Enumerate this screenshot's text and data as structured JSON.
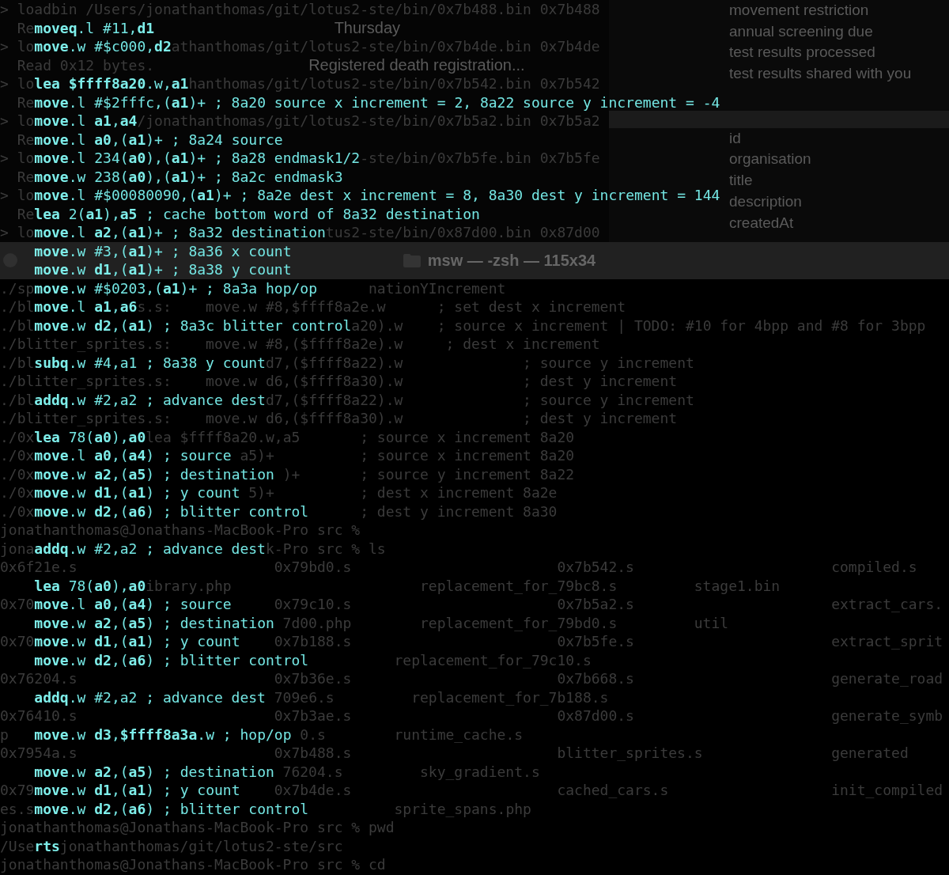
{
  "top_terminal": {
    "rows": [
      {
        "segments": [
          {
            "text": "> loadbin /Users/jonathanthomas/git/lotus2-ste/bin/0x7b488.bin 0x7b488",
            "kind": "term"
          }
        ]
      },
      {
        "segments": [
          {
            "text": "  Re",
            "kind": "term"
          },
          {
            "text": "                                   Thursday",
            "kind": "page"
          }
        ]
      },
      {
        "segments": [
          {
            "text": "> lo",
            "kind": "term"
          },
          {
            "text": "                athanthomas/git/lotus2-ste/bin/0x7b4de.bin 0x7b4de",
            "kind": "term"
          }
        ]
      },
      {
        "segments": [
          {
            "text": "  Read 0x12 bytes.",
            "kind": "term"
          },
          {
            "text": "                  Registered death registration...",
            "kind": "page"
          }
        ]
      },
      {
        "segments": [
          {
            "text": "> lo",
            "kind": "term"
          },
          {
            "text": "                  hanthomas/git/lotus2-ste/bin/0x7b542.bin 0x7b542",
            "kind": "term"
          }
        ]
      },
      {
        "segments": [
          {
            "text": "  Re",
            "kind": "term"
          }
        ]
      },
      {
        "segments": [
          {
            "text": "> lo",
            "kind": "term"
          },
          {
            "text": "            /jonathanthomas/git/lotus2-ste/bin/0x7b5a2.bin 0x7b5a2",
            "kind": "term"
          }
        ]
      },
      {
        "segments": [
          {
            "text": "  Re",
            "kind": "term"
          }
        ]
      },
      {
        "segments": [
          {
            "text": "> lo",
            "kind": "term"
          },
          {
            "text": "                                      -ste/bin/0x7b5fe.bin 0x7b5fe",
            "kind": "term"
          }
        ]
      },
      {
        "segments": [
          {
            "text": "  Re",
            "kind": "term"
          }
        ]
      },
      {
        "segments": [
          {
            "text": "> lo",
            "kind": "term"
          }
        ]
      },
      {
        "segments": [
          {
            "text": "  Re",
            "kind": "term"
          }
        ]
      },
      {
        "segments": [
          {
            "text": "> lo",
            "kind": "term"
          },
          {
            "text": "                                  tus2-ste/bin/0x87d00.bin 0x87d00",
            "kind": "term"
          }
        ]
      }
    ]
  },
  "browser_panel": {
    "upper_items": [
      "movement restriction",
      "annual screening due",
      "test results processed",
      "test results shared with you"
    ],
    "lower_items": [
      "id",
      "organisation",
      "title",
      "description",
      "createdAt"
    ]
  },
  "title_bar": {
    "title": "msw — -zsh — 115x34"
  },
  "terminal": {
    "rows": [
      {
        "segments": [
          {
            "text": "./sp",
            "kind": "term"
          },
          {
            "text": "                                       nationYIncrement",
            "kind": "term"
          }
        ]
      },
      {
        "segments": [
          {
            "text": "./bl",
            "kind": "term"
          },
          {
            "text": "            s.s:    move.w #8,$ffff8a2e.w      ; set dest x increment",
            "kind": "term"
          }
        ]
      },
      {
        "segments": [
          {
            "text": "./bl",
            "kind": "term"
          },
          {
            "text": "                                     a20).w    ; source x increment | TODO: #10 for 4bpp and #8 for 3bpp",
            "kind": "term"
          }
        ]
      },
      {
        "segments": [
          {
            "text": "./blitter_sprites.s:    move.w #8,($ffff8a2e).w     ; dest x increment",
            "kind": "term"
          }
        ]
      },
      {
        "segments": [
          {
            "text": "./bl",
            "kind": "term"
          },
          {
            "text": "                           d7,($ffff8a22).w              ; source y increment",
            "kind": "term"
          }
        ]
      },
      {
        "segments": [
          {
            "text": "./blitter_sprites.s:    move.w d6,($ffff8a30).w              ; dest y increment",
            "kind": "term"
          }
        ]
      },
      {
        "segments": [
          {
            "text": "./bl",
            "kind": "term"
          },
          {
            "text": "                           d7,($ffff8a22).w              ; source y increment",
            "kind": "term"
          }
        ]
      },
      {
        "segments": [
          {
            "text": "./blitter_sprites.s:    move.w d6,($ffff8a30).w              ; dest y increment",
            "kind": "term"
          }
        ]
      },
      {
        "segments": [
          {
            "text": "./0x",
            "kind": "term"
          },
          {
            "text": "             lea $ffff8a20.w,a5       ; source x increment 8a20",
            "kind": "term"
          }
        ]
      },
      {
        "segments": [
          {
            "text": "./0x",
            "kind": "term"
          },
          {
            "text": "                        a5)+          ; source x increment 8a20",
            "kind": "term"
          }
        ]
      },
      {
        "segments": [
          {
            "text": "./0x",
            "kind": "term"
          },
          {
            "text": "                             )+       ; source y increment 8a22",
            "kind": "term"
          }
        ]
      },
      {
        "segments": [
          {
            "text": "./0x",
            "kind": "term"
          },
          {
            "text": "                         5)+          ; dest x increment 8a2e",
            "kind": "term"
          }
        ]
      },
      {
        "segments": [
          {
            "text": "./0x",
            "kind": "term"
          },
          {
            "text": "                                      ; dest y increment 8a30",
            "kind": "term"
          }
        ]
      },
      {
        "segments": [
          {
            "text": "jonathanthomas@Jonathans-MacBook-Pro src %",
            "kind": "term"
          }
        ]
      },
      {
        "segments": [
          {
            "text": "jona",
            "kind": "term"
          },
          {
            "text": "                           k-Pro src % ls",
            "kind": "term"
          }
        ]
      },
      {
        "segments": [
          {
            "text": "0x6f21e.s",
            "kind": "term"
          },
          {
            "text": "                       0x79bd0.s",
            "kind": "term"
          },
          {
            "text": "                        0x7b542.s",
            "kind": "term"
          },
          {
            "text": "                       compiled.s",
            "kind": "term"
          }
        ]
      },
      {
        "segments": [
          {
            "text": "                 ibrary.php",
            "kind": "term"
          },
          {
            "text": "                      replacement_for_79bc8.s",
            "kind": "term"
          },
          {
            "text": "         stage1.bin",
            "kind": "term"
          }
        ]
      },
      {
        "segments": [
          {
            "text": "0x70",
            "kind": "term"
          },
          {
            "text": "                            0x79c10.s",
            "kind": "term"
          },
          {
            "text": "                        0x7b5a2.s",
            "kind": "term"
          },
          {
            "text": "                       extract_cars.",
            "kind": "term"
          }
        ]
      },
      {
        "segments": [
          {
            "text": "                                 7d00.php",
            "kind": "term"
          },
          {
            "text": "        replacement_for_79bd0.s",
            "kind": "term"
          },
          {
            "text": "         util",
            "kind": "term"
          }
        ]
      },
      {
        "segments": [
          {
            "text": "0x70",
            "kind": "term"
          },
          {
            "text": "                            0x7b188.s",
            "kind": "term"
          },
          {
            "text": "                        0x7b5fe.s",
            "kind": "term"
          },
          {
            "text": "                       extract_sprit",
            "kind": "term"
          }
        ]
      },
      {
        "segments": [
          {
            "text": "                                              replacement_for_79c10.s",
            "kind": "term"
          }
        ]
      },
      {
        "segments": [
          {
            "text": "0x76204.s",
            "kind": "term"
          },
          {
            "text": "                       0x7b36e.s",
            "kind": "term"
          },
          {
            "text": "                        0x7b668.s",
            "kind": "term"
          },
          {
            "text": "                       generate_road",
            "kind": "term"
          }
        ]
      },
      {
        "segments": [
          {
            "text": "                                709e6.s",
            "kind": "term"
          },
          {
            "text": "         replacement_for_7b188.s",
            "kind": "term"
          }
        ]
      },
      {
        "segments": [
          {
            "text": "0x76410.s",
            "kind": "term"
          },
          {
            "text": "                       0x7b3ae.s",
            "kind": "term"
          },
          {
            "text": "                        0x87d00.s",
            "kind": "term"
          },
          {
            "text": "                       generate_symb",
            "kind": "term"
          }
        ]
      },
      {
        "segments": [
          {
            "text": "p",
            "kind": "term"
          },
          {
            "text": "                                  0.s",
            "kind": "term"
          },
          {
            "text": "        runtime_cache.s",
            "kind": "term"
          }
        ]
      },
      {
        "segments": [
          {
            "text": "0x7954a.s",
            "kind": "term"
          },
          {
            "text": "                       0x7b488.s",
            "kind": "term"
          },
          {
            "text": "                        blitter_sprites.s",
            "kind": "term"
          },
          {
            "text": "               generated",
            "kind": "term"
          }
        ]
      },
      {
        "segments": [
          {
            "text": "                                 76204.s",
            "kind": "term"
          },
          {
            "text": "         sky_gradient.s",
            "kind": "term"
          }
        ]
      },
      {
        "segments": [
          {
            "text": "0x79",
            "kind": "term"
          },
          {
            "text": "                            0x7b4de.s",
            "kind": "term"
          },
          {
            "text": "                        cached_cars.s",
            "kind": "term"
          },
          {
            "text": "                   init_compiled",
            "kind": "term"
          }
        ]
      },
      {
        "segments": [
          {
            "text": "es.s",
            "kind": "term"
          },
          {
            "text": "                                          sprite_spans.php",
            "kind": "term"
          }
        ]
      },
      {
        "segments": [
          {
            "text": "jonathanthomas@Jonathans-MacBook-Pro src % pwd",
            "kind": "term"
          }
        ]
      },
      {
        "segments": [
          {
            "text": "/Use",
            "kind": "term"
          },
          {
            "text": "   jonathanthomas/git/lotus2-ste/src",
            "kind": "term"
          }
        ]
      },
      {
        "segments": [
          {
            "text": "jonathanthomas@Jonathans-MacBook-Pro src % cd",
            "kind": "term"
          }
        ]
      }
    ]
  },
  "code_overlay": {
    "blocks": [
      [
        "**moveq**.l #11,**d1**",
        "**move**.w #$c000,**d2**"
      ],
      [
        "**lea $ffff8a20**.w,**a1**",
        "**move**.l #$2fffc,(**a1**)+ ; 8a20 source x increment = 2, 8a22 source y increment = -4",
        "**move**.l **a1**,**a4**",
        "**move**.l **a0**,(**a1**)+ ; 8a24 source",
        "**move**.l 234(**a0**),(**a1**)+ ; 8a28 endmask1/2",
        "**move**.w 238(**a0**),(**a1**)+ ; 8a2c endmask3",
        "**move**.l #$00080090,(**a1**)+ ; 8a2e dest x increment = 8, 8a30 dest y increment = 144",
        "**lea** 2(**a1**),**a5** ; cache bottom word of 8a32 destination",
        "**move**.l **a2**,(**a1**)+ ; 8a32 destination",
        "**move**.w #3,(**a1**)+ ; 8a36 x count",
        "**move**.w **d1**,(**a1**)+ ; 8a38 y count",
        "**move**.w #$0203,(**a1**)+ ; 8a3a hop/op",
        "**move**.l **a1**,**a6**",
        "**move**.w **d2**,(**a1**) ; 8a3c blitter control"
      ],
      [
        "**subq**.w #4,a1 ; 8a38 y count"
      ],
      [
        "**addq**.w #2,a2 ; advance dest"
      ],
      [
        "**lea** 78(**a0**),**a0**",
        "**move**.l **a0**,(**a4**) ; source",
        "**move**.w **a2**,(**a5**) ; destination",
        "**move**.w **d1**,(**a1**) ; y count",
        "**move**.w **d2**,(**a6**) ; blitter control"
      ],
      [
        "**addq**.w #2,a2 ; advance dest"
      ],
      [
        "**lea** 78(**a0**),**a0**",
        "**move**.l **a0**,(**a4**) ; source",
        "**move**.w **a2**,(**a5**) ; destination",
        "**move**.w **d1**,(**a1**) ; y count",
        "**move**.w **d2**,(**a6**) ; blitter control"
      ],
      [
        "**addq**.w #2,a2 ; advance dest"
      ],
      [
        "**move**.w **d3**,**$ffff8a3a**.w ; hop/op"
      ],
      [
        "**move**.w **a2**,(**a5**) ; destination",
        "**move**.w **d1**,(**a1**) ; y count",
        "**move**.w **d2**,(**a6**) ; blitter control"
      ],
      [
        "**rts**"
      ]
    ]
  }
}
